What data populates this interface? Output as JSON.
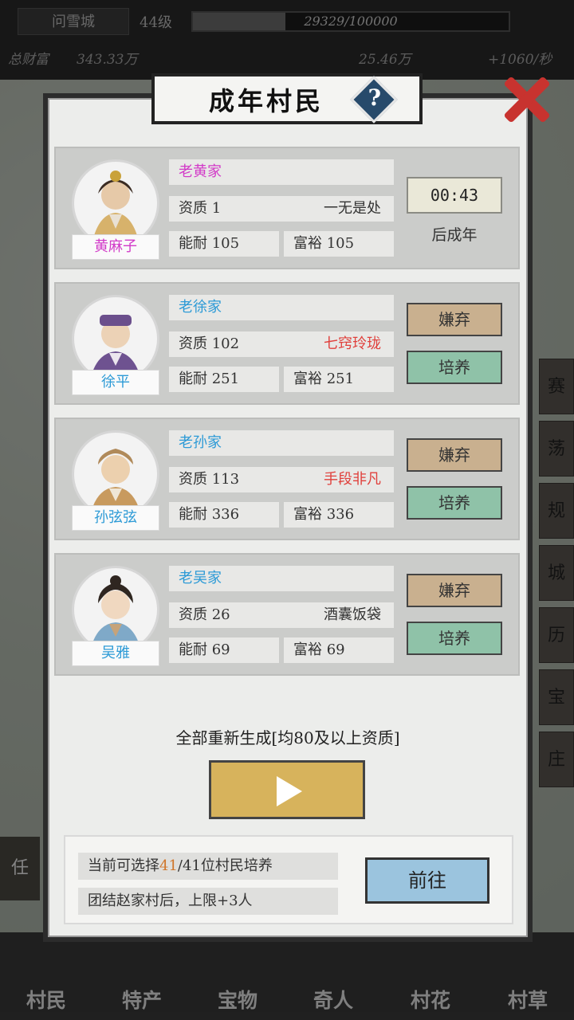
{
  "topbar": {
    "city": "问雪城",
    "level": "44级",
    "exp_text": "29329/100000",
    "exp_progress": 0.29329,
    "total_wealth_label": "总财富",
    "total_wealth": "343.33万",
    "coins": "25.46万",
    "rate": "+1060/秒"
  },
  "modal": {
    "title": "成年村民",
    "help_symbol": "?",
    "villagers": [
      {
        "family": "老黄家",
        "name": "黄麻子",
        "name_color": "#d23ac8",
        "aptitude": "资质 1",
        "trait": "一无是处",
        "trait_color": "#333333",
        "endurance": "能耐 105",
        "wealth": "富裕 105",
        "timer": "00:43",
        "timer_label": "后成年"
      },
      {
        "family": "老徐家",
        "name": "徐平",
        "name_color": "#2c9ad6",
        "aptitude": "资质 102",
        "trait": "七窍玲珑",
        "trait_color": "#e0403c",
        "endurance": "能耐 251",
        "wealth": "富裕 251",
        "discard": "嫌弃",
        "train": "培养"
      },
      {
        "family": "老孙家",
        "name": "孙弦弦",
        "name_color": "#2c9ad6",
        "aptitude": "资质 113",
        "trait": "手段非凡",
        "trait_color": "#e0403c",
        "endurance": "能耐 336",
        "wealth": "富裕 336",
        "discard": "嫌弃",
        "train": "培养"
      },
      {
        "family": "老吴家",
        "name": "吴雅",
        "name_color": "#2c9ad6",
        "aptitude": "资质 26",
        "trait": "酒囊饭袋",
        "trait_color": "#333333",
        "endurance": "能耐 69",
        "wealth": "富裕 69",
        "discard": "嫌弃",
        "train": "培养"
      }
    ],
    "regen_label": "全部重新生成[均80及以上资质]",
    "info": {
      "line1_prefix": "当前可选择",
      "line1_highlight": "41",
      "line1_suffix": "/41位村民培养",
      "line2": "团结赵家村后，上限+3人",
      "goto": "前往"
    }
  },
  "side_tabs": [
    "赛",
    "荡",
    "规",
    "城",
    "历",
    "宝",
    "庄"
  ],
  "left_tab": "任",
  "bottom_nav": [
    "村民",
    "特产",
    "宝物",
    "奇人",
    "村花",
    "村草"
  ]
}
